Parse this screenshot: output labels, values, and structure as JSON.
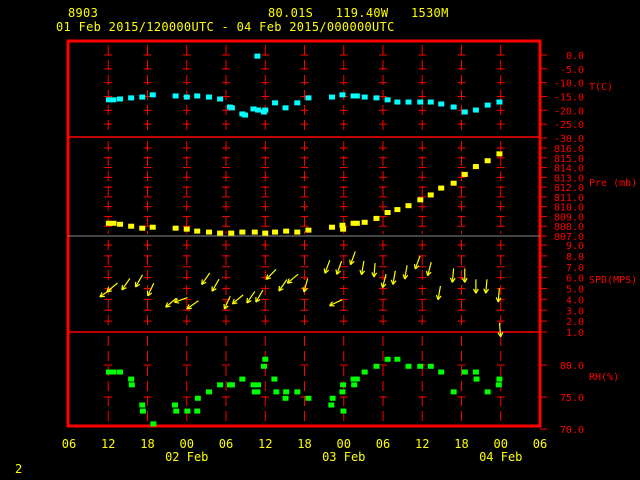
{
  "header": {
    "station_id": "8903",
    "location": "80.01S   119.40W   1530M",
    "time_range": "01 Feb 2015/120000UTC - 04 Feb 2015/000000UTC"
  },
  "footer": {
    "frame_number": "2"
  },
  "colors": {
    "frame": "#ff0000",
    "text": "#ffff00",
    "temperature": "#00ffff",
    "pressure": "#ffff00",
    "wind": "#ffff00",
    "rh": "#00ff00"
  },
  "chart_data": {
    "type": "scatter",
    "title": "01 Feb 2015/120000UTC - 04 Feb 2015/000000UTC",
    "x_units": "hours since 01 Feb 2015 06UTC",
    "xlim": [
      0,
      72
    ],
    "x_tick_labels": [
      "06",
      "12",
      "18",
      "00",
      "06",
      "12",
      "18",
      "00",
      "06",
      "12",
      "18",
      "00",
      "06"
    ],
    "date_labels": [
      {
        "label": "02 Feb",
        "hour": 18
      },
      {
        "label": "03 Feb",
        "hour": 42
      },
      {
        "label": "04 Feb",
        "hour": 66
      }
    ],
    "panels": [
      {
        "name": "T(C)",
        "ylim": [
          -30,
          0
        ],
        "tick_labels": [
          "0.0",
          "-5.0",
          "-10.0",
          "-15.0",
          "-20.0",
          "-25.0",
          "-30.0"
        ],
        "tick_values": [
          0,
          -5,
          -10,
          -15,
          -20,
          -25,
          -30
        ],
        "points": [
          [
            6.1,
            -16.2
          ],
          [
            6.8,
            -16.2
          ],
          [
            7.8,
            -15.9
          ],
          [
            9.5,
            -15.5
          ],
          [
            11.2,
            -15.2
          ],
          [
            12.8,
            -14.4
          ],
          [
            16.3,
            -14.8
          ],
          [
            18.0,
            -15.2
          ],
          [
            19.6,
            -14.8
          ],
          [
            21.4,
            -15.2
          ],
          [
            23.1,
            -15.9
          ],
          [
            24.6,
            -18.8
          ],
          [
            24.9,
            -19.1
          ],
          [
            26.5,
            -21.3
          ],
          [
            26.9,
            -21.7
          ],
          [
            28.2,
            -19.5
          ],
          [
            28.8,
            -0.4
          ],
          [
            28.9,
            -19.9
          ],
          [
            29.8,
            -20.6
          ],
          [
            30.0,
            -19.9
          ],
          [
            31.5,
            -17.3
          ],
          [
            33.1,
            -19.1
          ],
          [
            34.9,
            -17.3
          ],
          [
            36.6,
            -15.5
          ],
          [
            40.2,
            -15.2
          ],
          [
            41.8,
            -14.4
          ],
          [
            43.5,
            -14.8
          ],
          [
            44.0,
            -14.8
          ],
          [
            45.2,
            -15.2
          ],
          [
            47.0,
            -15.5
          ],
          [
            48.7,
            -16.2
          ],
          [
            50.2,
            -17.0
          ],
          [
            51.9,
            -17.0
          ],
          [
            53.7,
            -17.0
          ],
          [
            55.3,
            -17.0
          ],
          [
            56.9,
            -17.7
          ],
          [
            58.8,
            -18.8
          ],
          [
            60.5,
            -20.6
          ],
          [
            62.2,
            -19.9
          ],
          [
            64.0,
            -18.1
          ],
          [
            65.8,
            -17.0
          ]
        ]
      },
      {
        "name": "Pre (mb)",
        "ylim": [
          807,
          816
        ],
        "tick_labels": [
          "816.0",
          "815.0",
          "814.0",
          "813.0",
          "812.0",
          "811.0",
          "810.0",
          "809.0",
          "808.0",
          "807.0"
        ],
        "tick_values": [
          816,
          815,
          814,
          813,
          812,
          811,
          810,
          809,
          808,
          807
        ],
        "points": [
          [
            6.1,
            808.3
          ],
          [
            6.8,
            808.3
          ],
          [
            7.8,
            808.2
          ],
          [
            9.5,
            808.0
          ],
          [
            11.2,
            807.8
          ],
          [
            12.8,
            807.9
          ],
          [
            16.3,
            807.8
          ],
          [
            18.0,
            807.7
          ],
          [
            19.6,
            807.5
          ],
          [
            21.4,
            807.4
          ],
          [
            23.1,
            807.3
          ],
          [
            24.8,
            807.3
          ],
          [
            26.5,
            807.4
          ],
          [
            28.4,
            807.4
          ],
          [
            30.0,
            807.3
          ],
          [
            31.5,
            807.4
          ],
          [
            33.2,
            807.5
          ],
          [
            34.9,
            807.4
          ],
          [
            36.6,
            807.6
          ],
          [
            40.2,
            807.9
          ],
          [
            41.8,
            808.1
          ],
          [
            41.9,
            807.7
          ],
          [
            43.5,
            808.3
          ],
          [
            44.0,
            808.3
          ],
          [
            45.2,
            808.4
          ],
          [
            47.0,
            808.8
          ],
          [
            48.7,
            809.4
          ],
          [
            50.2,
            809.7
          ],
          [
            51.9,
            810.1
          ],
          [
            53.7,
            810.7
          ],
          [
            55.3,
            811.2
          ],
          [
            56.9,
            811.9
          ],
          [
            58.8,
            812.4
          ],
          [
            60.5,
            813.3
          ],
          [
            62.2,
            814.1
          ],
          [
            64.0,
            814.7
          ],
          [
            65.8,
            815.4
          ]
        ]
      },
      {
        "name": "SPD(MPS)",
        "ylim": [
          1,
          9
        ],
        "tick_labels": [
          "9.0",
          "8.0",
          "7.0",
          "6.0",
          "5.0",
          "4.0",
          "3.0",
          "2.0",
          "1.0"
        ],
        "tick_values": [
          9,
          8,
          7,
          6,
          5,
          4,
          3,
          2,
          1
        ],
        "points_heading_deg": [
          [
            5.6,
            4.6,
            235
          ],
          [
            6.6,
            5.1,
            230
          ],
          [
            8.7,
            5.4,
            215
          ],
          [
            10.7,
            5.7,
            210
          ],
          [
            12.5,
            4.9,
            205
          ],
          [
            15.6,
            3.7,
            230
          ],
          [
            17.1,
            3.95,
            250
          ],
          [
            18.9,
            3.5,
            235
          ],
          [
            20.9,
            5.9,
            215
          ],
          [
            22.4,
            5.3,
            210
          ],
          [
            24.2,
            3.7,
            205
          ],
          [
            25.8,
            4.0,
            230
          ],
          [
            27.8,
            4.2,
            215
          ],
          [
            29.1,
            4.3,
            210
          ],
          [
            30.9,
            6.3,
            225
          ],
          [
            32.7,
            5.3,
            215
          ],
          [
            34.2,
            5.9,
            230
          ],
          [
            36.2,
            5.3,
            195
          ],
          [
            39.5,
            7.0,
            200
          ],
          [
            40.8,
            3.7,
            245
          ],
          [
            41.3,
            6.9,
            200
          ],
          [
            43.4,
            7.8,
            200
          ],
          [
            44.9,
            6.9,
            190
          ],
          [
            46.7,
            6.7,
            185
          ],
          [
            48.2,
            5.7,
            195
          ],
          [
            49.7,
            6.0,
            190
          ],
          [
            51.5,
            6.5,
            190
          ],
          [
            53.3,
            7.4,
            200
          ],
          [
            55.1,
            6.8,
            195
          ],
          [
            56.6,
            4.6,
            190
          ],
          [
            58.7,
            6.2,
            185
          ],
          [
            60.5,
            6.2,
            180
          ],
          [
            62.2,
            5.2,
            180
          ],
          [
            63.8,
            5.2,
            185
          ],
          [
            65.7,
            4.4,
            185
          ],
          [
            65.9,
            1.2,
            175
          ]
        ]
      },
      {
        "name": "RH(%)",
        "ylim": [
          70,
          85
        ],
        "tick_labels": [
          "80.0",
          "75.0",
          "70.0"
        ],
        "tick_values": [
          80,
          75,
          70
        ],
        "points": [
          [
            6.1,
            78.9
          ],
          [
            6.8,
            78.9
          ],
          [
            7.8,
            78.9
          ],
          [
            9.5,
            77.8
          ],
          [
            9.6,
            76.9
          ],
          [
            11.2,
            73.75
          ],
          [
            11.3,
            72.8
          ],
          [
            12.9,
            70.8
          ],
          [
            16.2,
            73.75
          ],
          [
            16.4,
            72.8
          ],
          [
            18.1,
            72.8
          ],
          [
            19.6,
            72.8
          ],
          [
            19.7,
            74.8
          ],
          [
            21.4,
            75.8
          ],
          [
            23.1,
            76.9
          ],
          [
            24.6,
            76.9
          ],
          [
            24.9,
            76.9
          ],
          [
            26.5,
            77.8
          ],
          [
            28.2,
            76.9
          ],
          [
            28.4,
            75.8
          ],
          [
            28.8,
            75.8
          ],
          [
            28.9,
            76.9
          ],
          [
            29.8,
            79.8
          ],
          [
            30.0,
            80.9
          ],
          [
            31.4,
            77.8
          ],
          [
            31.7,
            75.8
          ],
          [
            33.1,
            74.8
          ],
          [
            33.2,
            75.8
          ],
          [
            34.9,
            75.8
          ],
          [
            36.6,
            74.8
          ],
          [
            40.1,
            73.75
          ],
          [
            40.3,
            74.8
          ],
          [
            41.8,
            75.8
          ],
          [
            41.9,
            76.9
          ],
          [
            41.95,
            72.8
          ],
          [
            43.5,
            77.8
          ],
          [
            43.6,
            76.9
          ],
          [
            44.0,
            77.8
          ],
          [
            45.2,
            78.9
          ],
          [
            47.0,
            79.8
          ],
          [
            48.7,
            80.9
          ],
          [
            50.2,
            80.9
          ],
          [
            51.9,
            79.8
          ],
          [
            53.7,
            79.8
          ],
          [
            55.3,
            79.8
          ],
          [
            56.9,
            78.9
          ],
          [
            58.8,
            75.8
          ],
          [
            60.5,
            78.9
          ],
          [
            62.2,
            78.9
          ],
          [
            62.3,
            77.8
          ],
          [
            64.0,
            75.8
          ],
          [
            65.7,
            76.9
          ],
          [
            65.8,
            77.8
          ]
        ]
      }
    ]
  }
}
